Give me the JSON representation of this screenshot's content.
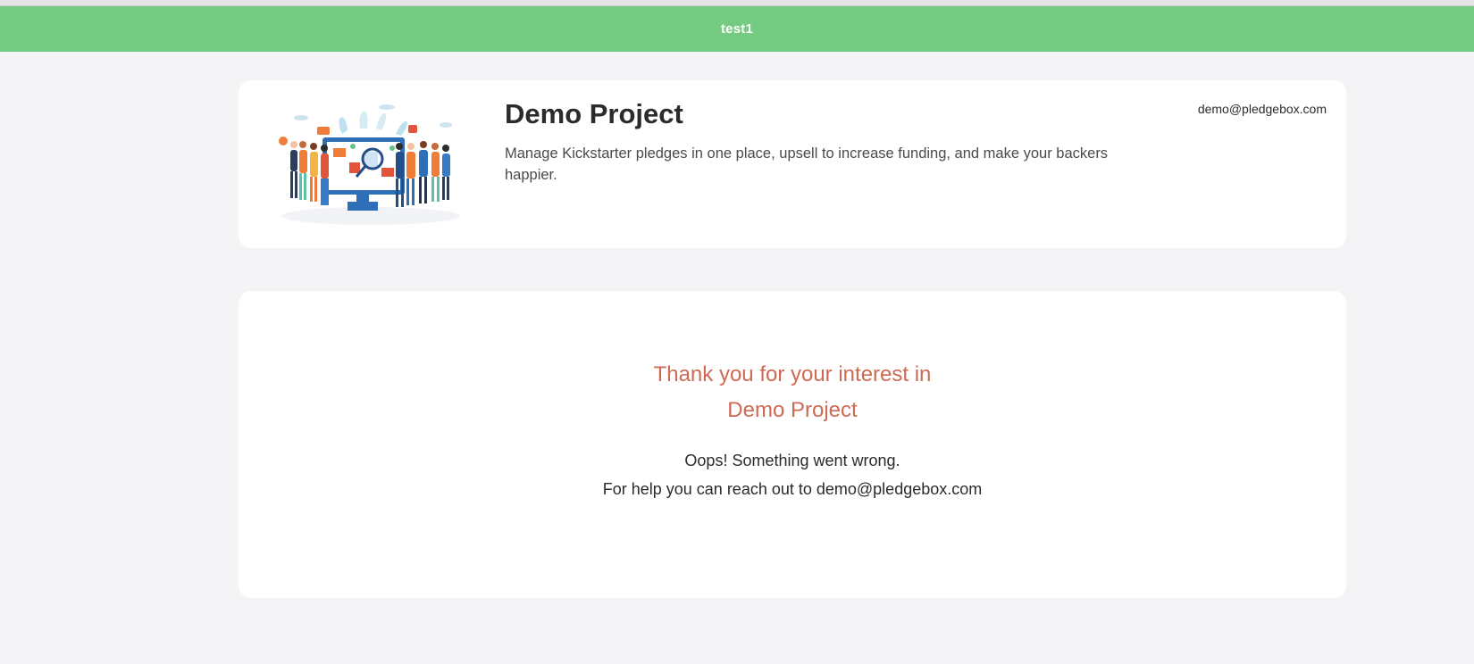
{
  "banner": {
    "title": "test1",
    "color": "#76cb82"
  },
  "project": {
    "name": "Demo Project",
    "description": "Manage Kickstarter pledges in one place, upsell to increase funding, and make your backers happier.",
    "contact_email": "demo@pledgebox.com",
    "illustration_icon": "team-dashboard-illustration"
  },
  "status": {
    "heading_line1": "Thank you for your interest in",
    "heading_line2": "Demo Project",
    "heading_color": "#cd6a55",
    "error_line": "Oops! Something went wrong.",
    "help_line": "For help you can reach out to demo@pledgebox.com"
  }
}
